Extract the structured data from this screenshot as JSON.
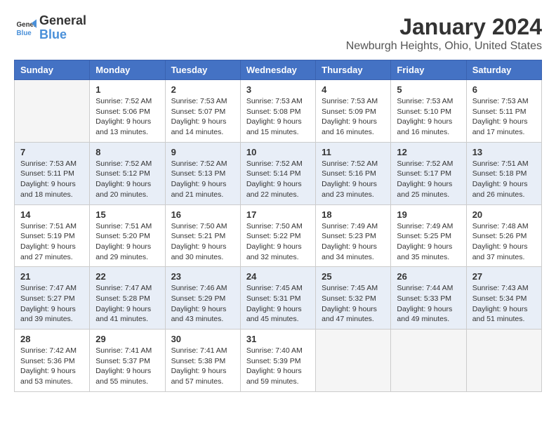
{
  "header": {
    "logo_line1": "General",
    "logo_line2": "Blue",
    "title": "January 2024",
    "subtitle": "Newburgh Heights, Ohio, United States"
  },
  "columns": [
    "Sunday",
    "Monday",
    "Tuesday",
    "Wednesday",
    "Thursday",
    "Friday",
    "Saturday"
  ],
  "weeks": [
    [
      {
        "day": "",
        "info": ""
      },
      {
        "day": "1",
        "info": "Sunrise: 7:52 AM\nSunset: 5:06 PM\nDaylight: 9 hours\nand 13 minutes."
      },
      {
        "day": "2",
        "info": "Sunrise: 7:53 AM\nSunset: 5:07 PM\nDaylight: 9 hours\nand 14 minutes."
      },
      {
        "day": "3",
        "info": "Sunrise: 7:53 AM\nSunset: 5:08 PM\nDaylight: 9 hours\nand 15 minutes."
      },
      {
        "day": "4",
        "info": "Sunrise: 7:53 AM\nSunset: 5:09 PM\nDaylight: 9 hours\nand 16 minutes."
      },
      {
        "day": "5",
        "info": "Sunrise: 7:53 AM\nSunset: 5:10 PM\nDaylight: 9 hours\nand 16 minutes."
      },
      {
        "day": "6",
        "info": "Sunrise: 7:53 AM\nSunset: 5:11 PM\nDaylight: 9 hours\nand 17 minutes."
      }
    ],
    [
      {
        "day": "7",
        "info": "Sunrise: 7:53 AM\nSunset: 5:11 PM\nDaylight: 9 hours\nand 18 minutes."
      },
      {
        "day": "8",
        "info": "Sunrise: 7:52 AM\nSunset: 5:12 PM\nDaylight: 9 hours\nand 20 minutes."
      },
      {
        "day": "9",
        "info": "Sunrise: 7:52 AM\nSunset: 5:13 PM\nDaylight: 9 hours\nand 21 minutes."
      },
      {
        "day": "10",
        "info": "Sunrise: 7:52 AM\nSunset: 5:14 PM\nDaylight: 9 hours\nand 22 minutes."
      },
      {
        "day": "11",
        "info": "Sunrise: 7:52 AM\nSunset: 5:16 PM\nDaylight: 9 hours\nand 23 minutes."
      },
      {
        "day": "12",
        "info": "Sunrise: 7:52 AM\nSunset: 5:17 PM\nDaylight: 9 hours\nand 25 minutes."
      },
      {
        "day": "13",
        "info": "Sunrise: 7:51 AM\nSunset: 5:18 PM\nDaylight: 9 hours\nand 26 minutes."
      }
    ],
    [
      {
        "day": "14",
        "info": "Sunrise: 7:51 AM\nSunset: 5:19 PM\nDaylight: 9 hours\nand 27 minutes."
      },
      {
        "day": "15",
        "info": "Sunrise: 7:51 AM\nSunset: 5:20 PM\nDaylight: 9 hours\nand 29 minutes."
      },
      {
        "day": "16",
        "info": "Sunrise: 7:50 AM\nSunset: 5:21 PM\nDaylight: 9 hours\nand 30 minutes."
      },
      {
        "day": "17",
        "info": "Sunrise: 7:50 AM\nSunset: 5:22 PM\nDaylight: 9 hours\nand 32 minutes."
      },
      {
        "day": "18",
        "info": "Sunrise: 7:49 AM\nSunset: 5:23 PM\nDaylight: 9 hours\nand 34 minutes."
      },
      {
        "day": "19",
        "info": "Sunrise: 7:49 AM\nSunset: 5:25 PM\nDaylight: 9 hours\nand 35 minutes."
      },
      {
        "day": "20",
        "info": "Sunrise: 7:48 AM\nSunset: 5:26 PM\nDaylight: 9 hours\nand 37 minutes."
      }
    ],
    [
      {
        "day": "21",
        "info": "Sunrise: 7:47 AM\nSunset: 5:27 PM\nDaylight: 9 hours\nand 39 minutes."
      },
      {
        "day": "22",
        "info": "Sunrise: 7:47 AM\nSunset: 5:28 PM\nDaylight: 9 hours\nand 41 minutes."
      },
      {
        "day": "23",
        "info": "Sunrise: 7:46 AM\nSunset: 5:29 PM\nDaylight: 9 hours\nand 43 minutes."
      },
      {
        "day": "24",
        "info": "Sunrise: 7:45 AM\nSunset: 5:31 PM\nDaylight: 9 hours\nand 45 minutes."
      },
      {
        "day": "25",
        "info": "Sunrise: 7:45 AM\nSunset: 5:32 PM\nDaylight: 9 hours\nand 47 minutes."
      },
      {
        "day": "26",
        "info": "Sunrise: 7:44 AM\nSunset: 5:33 PM\nDaylight: 9 hours\nand 49 minutes."
      },
      {
        "day": "27",
        "info": "Sunrise: 7:43 AM\nSunset: 5:34 PM\nDaylight: 9 hours\nand 51 minutes."
      }
    ],
    [
      {
        "day": "28",
        "info": "Sunrise: 7:42 AM\nSunset: 5:36 PM\nDaylight: 9 hours\nand 53 minutes."
      },
      {
        "day": "29",
        "info": "Sunrise: 7:41 AM\nSunset: 5:37 PM\nDaylight: 9 hours\nand 55 minutes."
      },
      {
        "day": "30",
        "info": "Sunrise: 7:41 AM\nSunset: 5:38 PM\nDaylight: 9 hours\nand 57 minutes."
      },
      {
        "day": "31",
        "info": "Sunrise: 7:40 AM\nSunset: 5:39 PM\nDaylight: 9 hours\nand 59 minutes."
      },
      {
        "day": "",
        "info": ""
      },
      {
        "day": "",
        "info": ""
      },
      {
        "day": "",
        "info": ""
      }
    ]
  ]
}
